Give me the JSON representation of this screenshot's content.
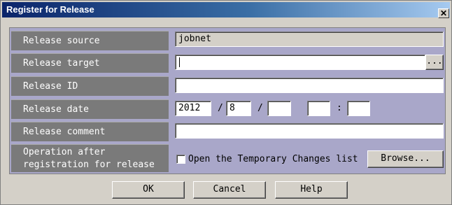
{
  "window": {
    "title": "Register for Release",
    "close_glyph": "✕"
  },
  "form": {
    "release_source": {
      "label": "Release source",
      "value": "jobnet"
    },
    "release_target": {
      "label": "Release target",
      "value": "",
      "browse_label": "..."
    },
    "release_id": {
      "label": "Release ID",
      "value": ""
    },
    "release_date": {
      "label": "Release date",
      "year": "2012",
      "month": "8",
      "day": "",
      "hour": "",
      "minute": "",
      "date_separator": "/",
      "time_separator": ":"
    },
    "release_comment": {
      "label": "Release comment",
      "value": ""
    },
    "operation_after": {
      "label_line1": "Operation after",
      "label_line2": "registration for release",
      "checkbox_label": "Open the Temporary Changes list",
      "checked": false,
      "browse_label": "Browse..."
    }
  },
  "buttons": {
    "ok": "OK",
    "cancel": "Cancel",
    "help": "Help"
  }
}
